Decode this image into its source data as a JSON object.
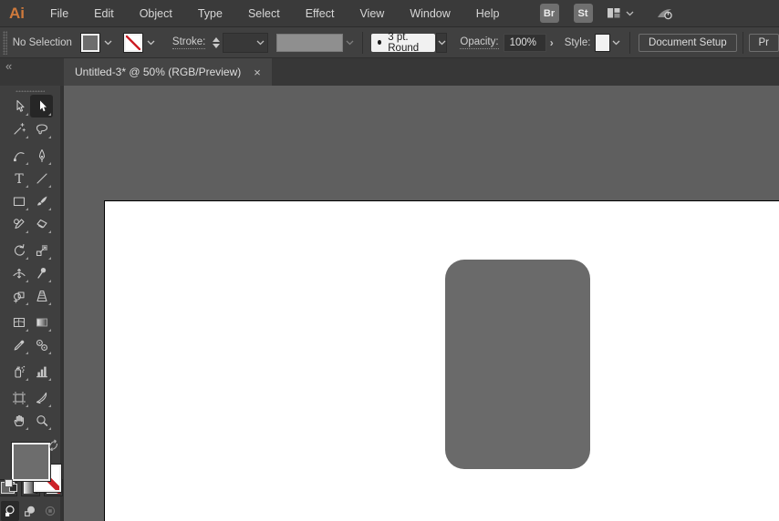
{
  "app": {
    "logo": "Ai"
  },
  "menubar": {
    "items": [
      "File",
      "Edit",
      "Object",
      "Type",
      "Select",
      "Effect",
      "View",
      "Window",
      "Help"
    ],
    "bridge_label": "Br",
    "stock_label": "St"
  },
  "controlbar": {
    "selection_status": "No Selection",
    "stroke_label": "Stroke:",
    "brush_definition": "3 pt. Round",
    "opacity_label": "Opacity:",
    "opacity_value": "100%",
    "opacity_expander": "›",
    "style_label": "Style:",
    "document_setup_label": "Document Setup",
    "preferences_label": "Pr"
  },
  "tabbar": {
    "collapse_glyph": "«",
    "active_tab_title": "Untitled-3* @ 50% (RGB/Preview)",
    "close_glyph": "×"
  },
  "toolbar": {
    "tools": [
      {
        "name": "selection-tool"
      },
      {
        "name": "direct-selection-tool",
        "active": true
      },
      {
        "name": "magic-wand-tool"
      },
      {
        "name": "lasso-tool",
        "sep_after": true
      },
      {
        "name": "curvature-tool"
      },
      {
        "name": "pen-tool"
      },
      {
        "name": "type-tool"
      },
      {
        "name": "line-segment-tool"
      },
      {
        "name": "rectangle-tool"
      },
      {
        "name": "paintbrush-tool"
      },
      {
        "name": "shaper-tool"
      },
      {
        "name": "eraser-tool",
        "sep_after": true
      },
      {
        "name": "rotate-tool"
      },
      {
        "name": "scale-tool"
      },
      {
        "name": "width-tool"
      },
      {
        "name": "puppet-warp-tool"
      },
      {
        "name": "shape-builder-tool"
      },
      {
        "name": "perspective-grid-tool",
        "sep_after": true
      },
      {
        "name": "mesh-tool"
      },
      {
        "name": "gradient-tool"
      },
      {
        "name": "eyedropper-tool"
      },
      {
        "name": "blend-tool",
        "sep_after": true
      },
      {
        "name": "symbol-sprayer-tool"
      },
      {
        "name": "column-graph-tool",
        "sep_after": true
      },
      {
        "name": "artboard-tool"
      },
      {
        "name": "slice-tool"
      },
      {
        "name": "hand-tool"
      },
      {
        "name": "zoom-tool"
      }
    ],
    "drawing_modes": [
      {
        "name": "draw-normal-mode",
        "active": true
      },
      {
        "name": "draw-behind-mode"
      },
      {
        "name": "draw-inside-mode",
        "disabled": true
      }
    ]
  },
  "canvas": {
    "shape": {
      "type": "rounded-rectangle",
      "fill": "#6a6a6a"
    }
  },
  "colors": {
    "logo_orange": "#cf7a3c",
    "none_indicator_red": "#cc2229",
    "canvas_background": "#5f5f5f",
    "artboard_white": "#ffffff",
    "current_fill_gray": "#6d6d6d"
  }
}
